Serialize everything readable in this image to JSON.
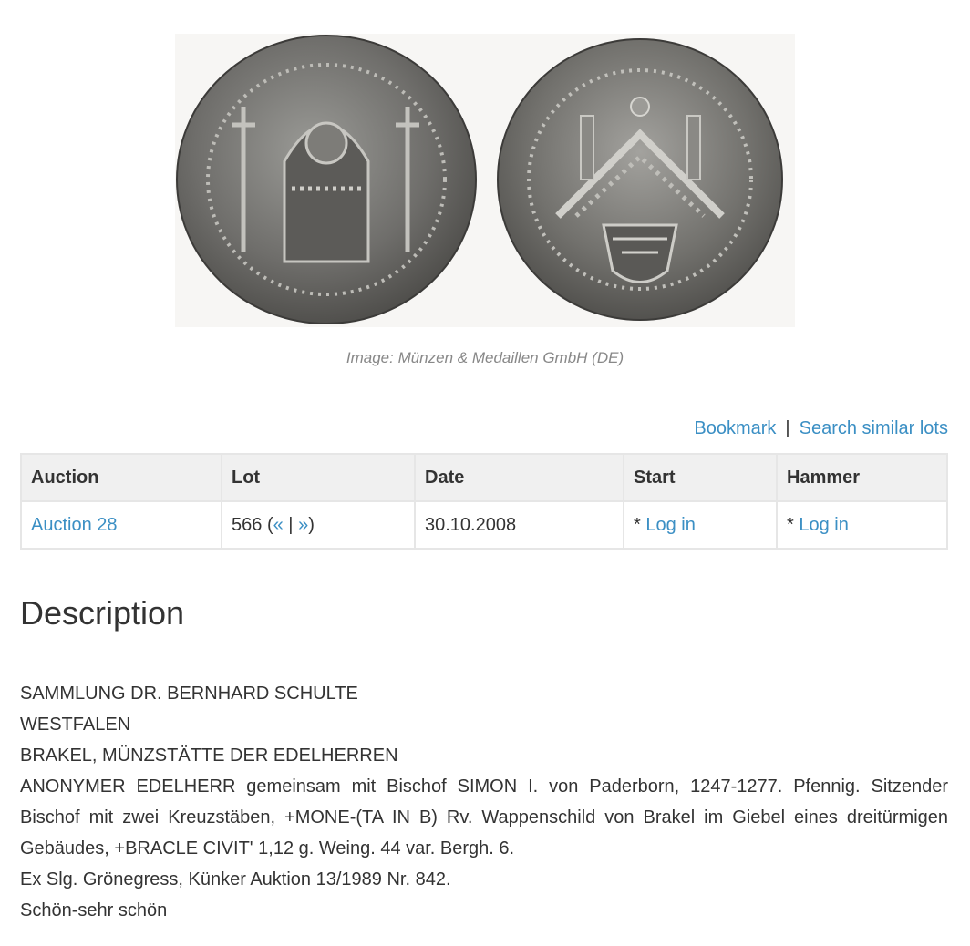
{
  "image": {
    "caption": "Image: Münzen & Medaillen GmbH (DE)"
  },
  "actions": {
    "bookmark": "Bookmark",
    "separator": "|",
    "search_similar": "Search similar lots"
  },
  "table": {
    "headers": [
      "Auction",
      "Lot",
      "Date",
      "Start",
      "Hammer"
    ],
    "row": {
      "auction": "Auction 28",
      "lot_number": "566",
      "lot_open": "(",
      "lot_prev": "«",
      "lot_sep": "|",
      "lot_next": "»",
      "lot_close": ")",
      "date": "30.10.2008",
      "start_prefix": "* ",
      "start_link": "Log in",
      "hammer_prefix": "* ",
      "hammer_link": "Log in"
    }
  },
  "description": {
    "title": "Description",
    "lines": [
      "SAMMLUNG DR. BERNHARD SCHULTE",
      "WESTFALEN",
      "BRAKEL, MÜNZSTÄTTE DER EDELHERREN",
      "ANONYMER EDELHERR gemeinsam mit Bischof SIMON I. von Paderborn, 1247-1277. Pfennig. Sitzender Bischof mit zwei Kreuzstäben, +MONE-(TA IN B) Rv. Wappenschild von Brakel im Giebel eines dreitürmigen Gebäudes, +BRACLE CIVIT' 1,12 g. Weing. 44 var. Bergh. 6.",
      "Ex Slg. Grönegress, Künker Auktion 13/1989 Nr. 842.",
      "Schön-sehr schön"
    ]
  },
  "colors": {
    "link": "#3b8fc4",
    "header_bg": "#f0f0f0",
    "border": "#e6e6e6",
    "text": "#333333",
    "caption": "#888888"
  }
}
